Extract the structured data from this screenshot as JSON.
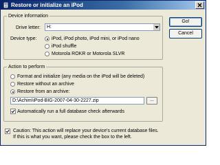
{
  "window": {
    "title": "Restore or initialize an iPod",
    "icon": "ipod-icon"
  },
  "buttons": {
    "go": "Go!",
    "cancel": "Cancel",
    "browse": "..."
  },
  "device_info": {
    "legend": "Device information",
    "drive_letter_label": "Drive letter:",
    "drive_letter_value": "H:",
    "device_type_label": "Device type:",
    "device_types": [
      {
        "label": "iPod, iPod photo, iPod mini, or iPod nano",
        "selected": true
      },
      {
        "label": "iPod shuffle",
        "selected": false
      },
      {
        "label": "Motorola ROKR or Motorola SLVR",
        "selected": false
      }
    ]
  },
  "action": {
    "legend": "Action to perform",
    "options": [
      {
        "label": "Format and initialize (any media on the iPod will be deleted)",
        "selected": false
      },
      {
        "label": "Restore without an archive",
        "selected": false
      },
      {
        "label": "Restore from an archive:",
        "selected": true
      }
    ],
    "archive_path": "D:\\Achim\\iPod-BIG-2007-04-30-2227.zip",
    "auto_check_label": "Automatically run a full database check afterwards",
    "auto_check_checked": true
  },
  "caution": {
    "checked": true,
    "line1": "Caution: This action will replace your device's current database files.",
    "line2": "If this is what you want, please check the box to the left."
  }
}
